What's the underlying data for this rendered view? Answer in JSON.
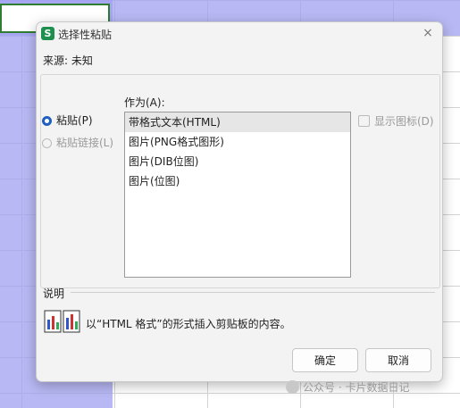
{
  "dialog": {
    "app_icon_letter": "S",
    "title": "选择性粘贴",
    "close_symbol": "×",
    "source_label": "来源:",
    "source_value": "未知",
    "as_label": "作为(A):",
    "radio_paste": "粘贴(P)",
    "radio_paste_link": "粘贴链接(L)",
    "show_icon_label": "显示图标(D)",
    "list_items": [
      "带格式文本(HTML)",
      "图片(PNG格式图形)",
      "图片(DIB位图)",
      "图片(位图)"
    ],
    "description_label": "说明",
    "description_text": "以“HTML 格式”的形式插入剪贴板的内容。",
    "ok_label": "确定",
    "cancel_label": "取消"
  },
  "watermark": {
    "text": "公众号 · 卡片数据日记"
  },
  "icons": {
    "app": "spreadsheet-app-icon",
    "close": "close-icon",
    "description": "paste-preview-icon",
    "watermark": "wechat-icon"
  },
  "colors": {
    "accent": "#1f5fbf",
    "app_green": "#1e8f4e",
    "selection": "#a0a0f0"
  }
}
